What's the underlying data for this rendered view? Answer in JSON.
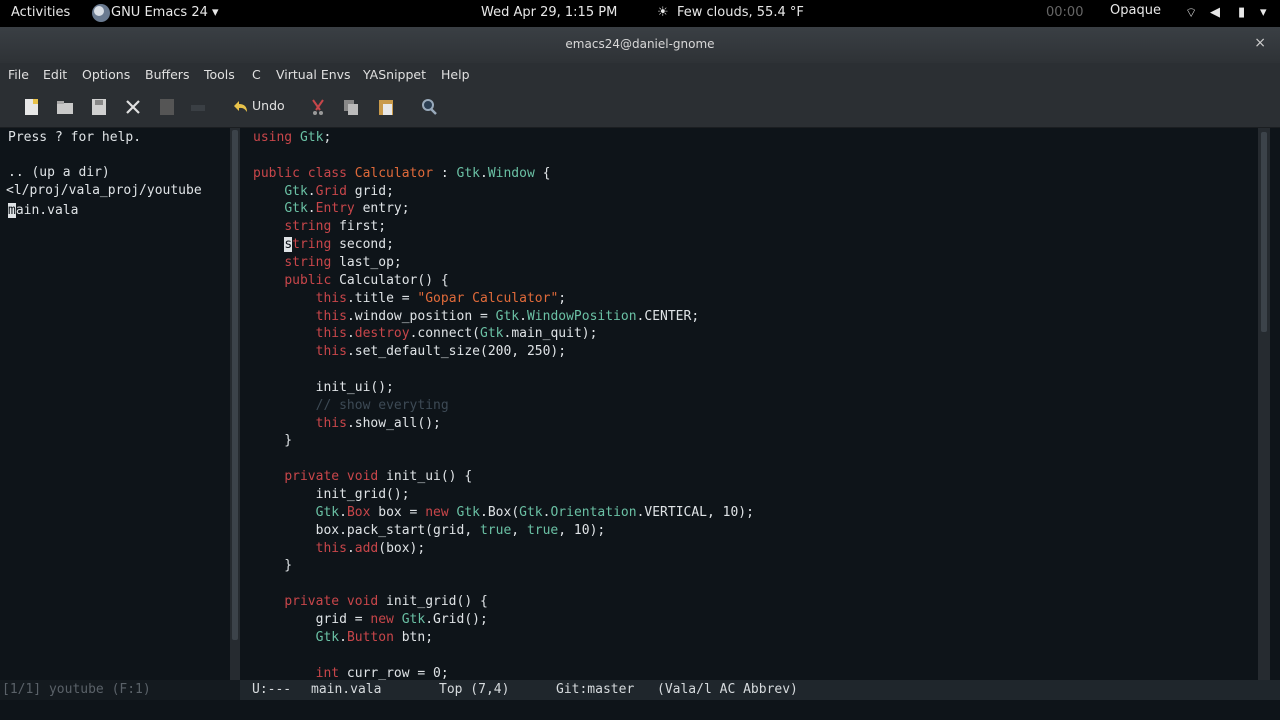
{
  "topbar": {
    "activities": "Activities",
    "app_menu": "GNU Emacs 24 ▾",
    "clock": "Wed Apr 29,  1:15 PM",
    "weather": "Few clouds, 55.4 °F",
    "timer": "00:00",
    "opaque": "Opaque"
  },
  "window": {
    "title": "emacs24@daniel-gnome",
    "close": "×"
  },
  "menu": [
    "File",
    "Edit",
    "Options",
    "Buffers",
    "Tools",
    "C",
    "Virtual Envs",
    "YASnippet",
    "Help"
  ],
  "toolbar": {
    "undo_label": "Undo"
  },
  "dired": {
    "help": "Press ? for help.",
    "updir": ".. (up a dir)",
    "path": "<l/proj/vala_proj/youtube",
    "file_cursor": "m",
    "file_rest": "ain.vala"
  },
  "code": [
    [
      [
        "k",
        "using"
      ],
      [
        "f",
        " "
      ],
      [
        "t",
        "Gtk"
      ],
      [
        "f",
        ";"
      ]
    ],
    [],
    [
      [
        "k",
        "public class"
      ],
      [
        "f",
        " "
      ],
      [
        "s",
        "Calculator"
      ],
      [
        "f",
        " : "
      ],
      [
        "t",
        "Gtk"
      ],
      [
        "f",
        "."
      ],
      [
        "t",
        "Window"
      ],
      [
        "f",
        " {"
      ]
    ],
    [
      [
        "f",
        "    "
      ],
      [
        "t",
        "Gtk"
      ],
      [
        "f",
        "."
      ],
      [
        "k",
        "Grid"
      ],
      [
        "f",
        " grid;"
      ]
    ],
    [
      [
        "f",
        "    "
      ],
      [
        "t",
        "Gtk"
      ],
      [
        "f",
        "."
      ],
      [
        "k",
        "Entry"
      ],
      [
        "f",
        " entry;"
      ]
    ],
    [
      [
        "f",
        "    "
      ],
      [
        "k",
        "string"
      ],
      [
        "f",
        " first;"
      ]
    ],
    [
      [
        "f",
        "    "
      ],
      [
        "cur",
        "s"
      ],
      [
        "k",
        "tring"
      ],
      [
        "f",
        " second;"
      ]
    ],
    [
      [
        "f",
        "    "
      ],
      [
        "k",
        "string"
      ],
      [
        "f",
        " last_op;"
      ]
    ],
    [
      [
        "f",
        "    "
      ],
      [
        "k",
        "public"
      ],
      [
        "f",
        " Calculator() {"
      ]
    ],
    [
      [
        "f",
        "        "
      ],
      [
        "k",
        "this"
      ],
      [
        "f",
        ".title = "
      ],
      [
        "s",
        "\"Gopar Calculator\""
      ],
      [
        "f",
        ";"
      ]
    ],
    [
      [
        "f",
        "        "
      ],
      [
        "k",
        "this"
      ],
      [
        "f",
        ".window_position = "
      ],
      [
        "t",
        "Gtk"
      ],
      [
        "f",
        "."
      ],
      [
        "t",
        "WindowPosition"
      ],
      [
        "f",
        ".CENTER;"
      ]
    ],
    [
      [
        "f",
        "        "
      ],
      [
        "k",
        "this"
      ],
      [
        "f",
        "."
      ],
      [
        "k",
        "destroy"
      ],
      [
        "f",
        ".connect("
      ],
      [
        "t",
        "Gtk"
      ],
      [
        "f",
        ".main_quit);"
      ]
    ],
    [
      [
        "f",
        "        "
      ],
      [
        "k",
        "this"
      ],
      [
        "f",
        ".set_default_size(200, 250);"
      ]
    ],
    [],
    [
      [
        "f",
        "        init_ui();"
      ]
    ],
    [
      [
        "f",
        "        "
      ],
      [
        "c",
        "// show everyting"
      ]
    ],
    [
      [
        "f",
        "        "
      ],
      [
        "k",
        "this"
      ],
      [
        "f",
        ".show_all();"
      ]
    ],
    [
      [
        "f",
        "    }"
      ]
    ],
    [],
    [
      [
        "f",
        "    "
      ],
      [
        "k",
        "private void"
      ],
      [
        "f",
        " init_ui() {"
      ]
    ],
    [
      [
        "f",
        "        init_grid();"
      ]
    ],
    [
      [
        "f",
        "        "
      ],
      [
        "t",
        "Gtk"
      ],
      [
        "f",
        "."
      ],
      [
        "k",
        "Box"
      ],
      [
        "f",
        " box = "
      ],
      [
        "k",
        "new"
      ],
      [
        "f",
        " "
      ],
      [
        "t",
        "Gtk"
      ],
      [
        "f",
        ".Box("
      ],
      [
        "t",
        "Gtk"
      ],
      [
        "f",
        "."
      ],
      [
        "t",
        "Orientation"
      ],
      [
        "f",
        ".VERTICAL, 10);"
      ]
    ],
    [
      [
        "f",
        "        box.pack_start(grid, "
      ],
      [
        "t",
        "true"
      ],
      [
        "f",
        ", "
      ],
      [
        "t",
        "true"
      ],
      [
        "f",
        ", 10);"
      ]
    ],
    [
      [
        "f",
        "        "
      ],
      [
        "k",
        "this"
      ],
      [
        "f",
        "."
      ],
      [
        "k",
        "add"
      ],
      [
        "f",
        "(box);"
      ]
    ],
    [
      [
        "f",
        "    }"
      ]
    ],
    [],
    [
      [
        "f",
        "    "
      ],
      [
        "k",
        "private void"
      ],
      [
        "f",
        " init_grid() {"
      ]
    ],
    [
      [
        "f",
        "        grid = "
      ],
      [
        "k",
        "new"
      ],
      [
        "f",
        " "
      ],
      [
        "t",
        "Gtk"
      ],
      [
        "f",
        ".Grid();"
      ]
    ],
    [
      [
        "f",
        "        "
      ],
      [
        "t",
        "Gtk"
      ],
      [
        "f",
        "."
      ],
      [
        "k",
        "Button"
      ],
      [
        "f",
        " btn;"
      ]
    ],
    [],
    [
      [
        "f",
        "        "
      ],
      [
        "k",
        "int"
      ],
      [
        "f",
        " curr_row = 0;"
      ]
    ]
  ],
  "modeline": {
    "left": "[1/1] youtube (F:1)",
    "state": "U:---",
    "buffer": "main.vala",
    "position": "Top (7,4)",
    "vc": "Git:master",
    "modes": "(Vala/l AC Abbrev)"
  },
  "colors": {
    "keyword": "#c8464a",
    "type": "#6ac0a4",
    "string": "#e06a3a",
    "comment": "#3d4a55",
    "bg": "#0e1419"
  }
}
